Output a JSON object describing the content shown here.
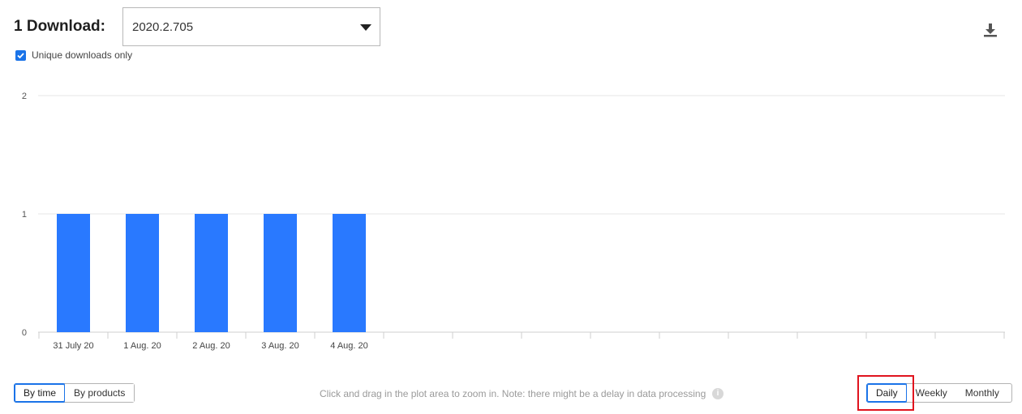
{
  "header": {
    "title": "1 Download:",
    "version_select": {
      "value": "2020.2.705"
    },
    "export_icon": "download-icon"
  },
  "options": {
    "unique_only": {
      "label": "Unique downloads only",
      "checked": true
    }
  },
  "chart_data": {
    "type": "bar",
    "categories": [
      "31 July 20",
      "1 Aug. 20",
      "2 Aug. 20",
      "3 Aug. 20",
      "4 Aug. 20",
      "",
      "",
      "",
      "",
      "",
      "",
      "",
      "",
      ""
    ],
    "values": [
      1,
      1,
      1,
      1,
      1,
      null,
      null,
      null,
      null,
      null,
      null,
      null,
      null,
      null
    ],
    "ylim": [
      0,
      2
    ],
    "yticks": [
      "0",
      "1",
      "2"
    ],
    "grid": true,
    "color": "#2979ff"
  },
  "footer": {
    "view_toggle": [
      {
        "label": "By time",
        "active": true
      },
      {
        "label": "By products",
        "active": false
      }
    ],
    "hint": "Click and drag in the plot area to zoom in. Note: there might be a delay in data processing",
    "info_icon": "info-icon",
    "granularity": [
      {
        "label": "Daily",
        "active": true
      },
      {
        "label": "Weekly",
        "active": false
      },
      {
        "label": "Monthly",
        "active": false
      }
    ]
  }
}
